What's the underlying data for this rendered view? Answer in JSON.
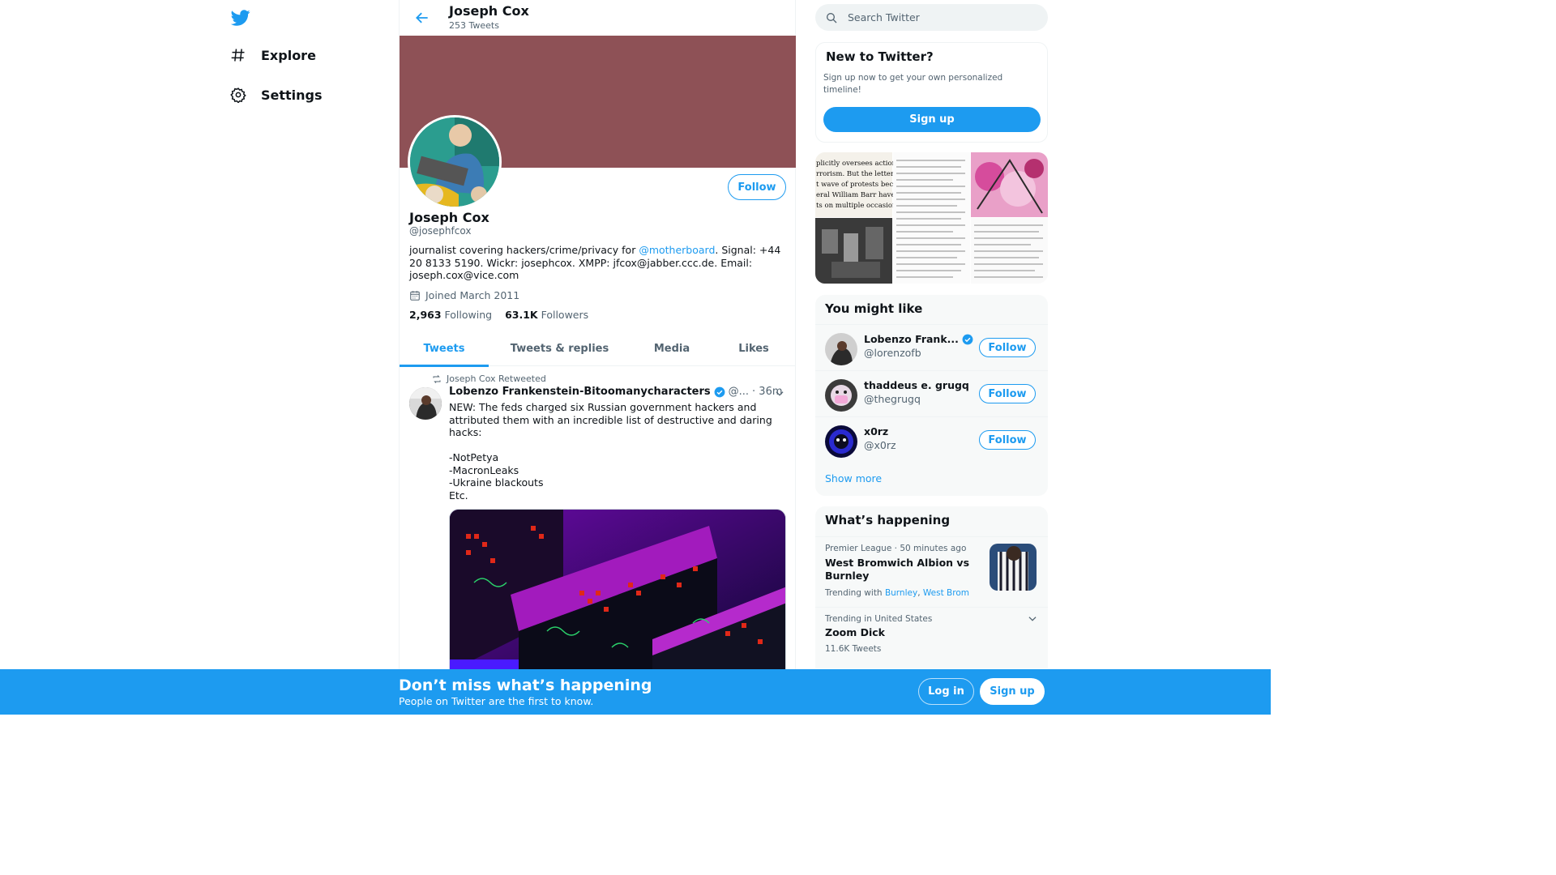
{
  "nav": {
    "logo_icon": "twitter-bird-icon",
    "items": [
      {
        "label": "Explore",
        "icon": "hashtag-icon"
      },
      {
        "label": "Settings",
        "icon": "gear-icon"
      }
    ]
  },
  "header": {
    "name": "Joseph Cox",
    "tweet_count": "253 Tweets"
  },
  "profile": {
    "name": "Joseph Cox",
    "handle": "@josephfcox",
    "follow_label": "Follow",
    "bio_prefix": "journalist covering hackers/crime/privacy for ",
    "bio_mention": "@motherboard",
    "bio_suffix": ". Signal: +44 20 8133 5190. Wickr: josephcox. XMPP: jfcox@jabber.ccc.de. Email: joseph.cox@vice.com",
    "joined": "Joined March 2011",
    "following_count": "2,963",
    "following_label": "Following",
    "followers_count": "63.1K",
    "followers_label": "Followers",
    "banner_color": "#8e5156"
  },
  "tabs": [
    {
      "label": "Tweets",
      "active": true
    },
    {
      "label": "Tweets & replies",
      "active": false
    },
    {
      "label": "Media",
      "active": false
    },
    {
      "label": "Likes",
      "active": false
    }
  ],
  "tweet": {
    "retweet_text": "Joseph Cox Retweeted",
    "author": "Lobenzo Frankenstein-Bitoomanycharacters",
    "handle_trunc": "@...",
    "time": "· 36m",
    "text": "NEW: The feds charged six Russian government hackers and attributed them with an incredible list of destructive and daring hacks:\n\n-NotPetya\n-MacronLeaks\n-Ukraine blackouts\nEtc."
  },
  "search": {
    "placeholder": "Search Twitter"
  },
  "new_to_twitter": {
    "title": "New to Twitter?",
    "subtitle": "Sign up now to get your own personalized timeline!",
    "signup_label": "Sign up"
  },
  "media_preview": {
    "quote_lines": [
      "plicitly oversees actions of",
      "rrorism. But the letter argue",
      "t wave of protests because",
      "eral William Barr have label",
      "ts on multiple occasions.\""
    ]
  },
  "who_to_follow": {
    "title": "You might like",
    "users": [
      {
        "name": "Lobenzo Frank...",
        "handle": "@lorenzofb",
        "verified": true,
        "follow_label": "Follow"
      },
      {
        "name": "thaddeus e. grugq",
        "handle": "@thegrugq",
        "verified": false,
        "follow_label": "Follow"
      },
      {
        "name": "x0rz",
        "handle": "@x0rz",
        "verified": false,
        "follow_label": "Follow"
      }
    ],
    "show_more": "Show more"
  },
  "happening": {
    "title": "What’s happening",
    "items": [
      {
        "category": "Premier League",
        "time": "50 minutes ago",
        "headline": "West Bromwich Albion vs Burnley",
        "trending_label": "Trending with",
        "tags": [
          "Burnley",
          "West Brom"
        ]
      },
      {
        "category": "Trending in United States",
        "headline": "Zoom Dick",
        "count": "11.6K Tweets"
      }
    ]
  },
  "bottom_bar": {
    "title": "Don’t miss what’s happening",
    "subtitle": "People on Twitter are the first to know.",
    "login_label": "Log in",
    "signup_label": "Sign up"
  },
  "colors": {
    "accent": "#1d9bf0",
    "text": "#0f1419",
    "muted": "#536471"
  }
}
